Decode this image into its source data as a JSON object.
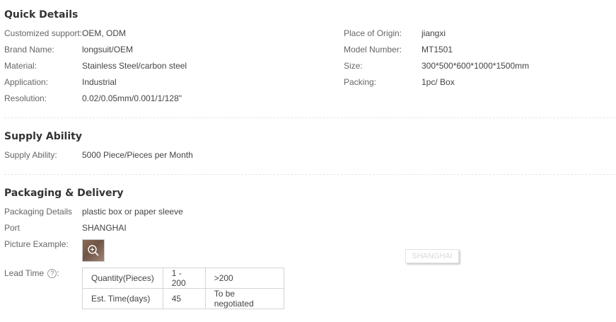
{
  "quick_details": {
    "title": "Quick Details",
    "left": [
      {
        "label": "Customized support:",
        "value": "OEM, ODM"
      },
      {
        "label": "Brand Name:",
        "value": "longsuit/OEM"
      },
      {
        "label": "Material:",
        "value": "Stainless Steel/carbon steel"
      },
      {
        "label": "Application:",
        "value": "Industrial"
      },
      {
        "label": "Resolution:",
        "value": "0.02/0.05mm/0.001/1/128\""
      }
    ],
    "right": [
      {
        "label": "Place of Origin:",
        "value": "jiangxi"
      },
      {
        "label": "Model Number:",
        "value": "MT1501"
      },
      {
        "label": "Size:",
        "value": "300*500*600*1000*1500mm"
      },
      {
        "label": "Packing:",
        "value": "1pc/ Box"
      }
    ]
  },
  "supply_ability": {
    "title": "Supply Ability",
    "label": "Supply Ability:",
    "value": "5000 Piece/Pieces per Month"
  },
  "packaging_delivery": {
    "title": "Packaging & Delivery",
    "packaging_details_label": "Packaging Details",
    "packaging_details_value": "plastic box or paper sleeve",
    "port_label": "Port",
    "port_value": "SHANGHAI",
    "picture_label": "Picture Example:",
    "picture_icon": "zoom-in-icon",
    "lead_time_label": "Lead Time",
    "lead_time_help": "?",
    "lead_time_table": [
      [
        "Quantity(Pieces)",
        "1 - 200",
        ">200"
      ],
      [
        "Est. Time(days)",
        "45",
        "To be negotiated"
      ]
    ]
  },
  "watermark": "SHANGHAI"
}
